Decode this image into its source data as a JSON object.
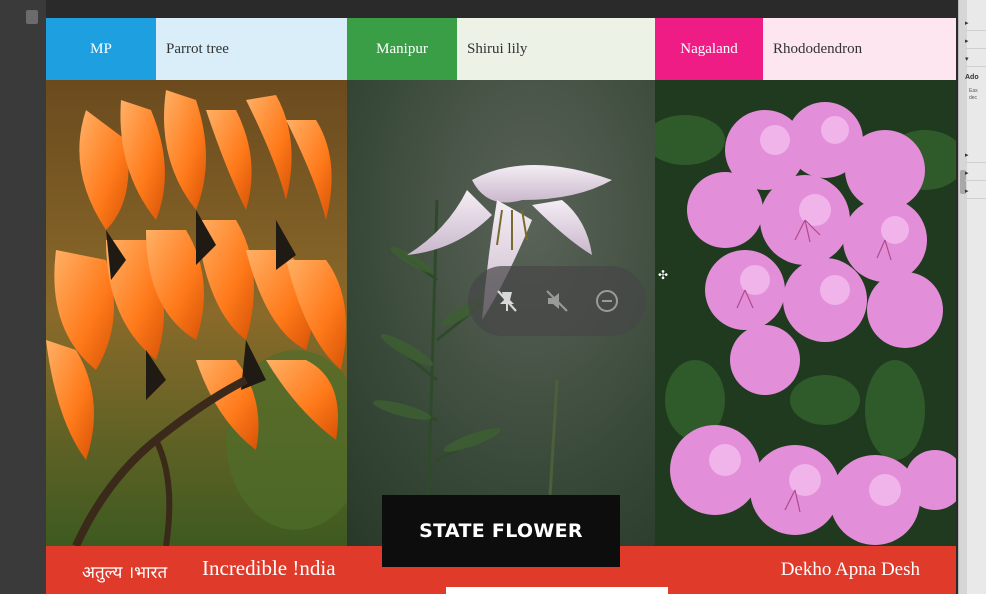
{
  "slide": {
    "columns": [
      {
        "state": "MP",
        "flower": "Parrot tree",
        "state_color": "#1e9fe0",
        "flower_bg": "#d9eef8"
      },
      {
        "state": "Manipur",
        "flower": "Shirui lily",
        "state_color": "#3a9e47",
        "flower_bg": "#ecf2e6"
      },
      {
        "state": "Nagaland",
        "flower": "Rhododendron",
        "state_color": "#ee1c84",
        "flower_bg": "#fde6ef"
      }
    ],
    "caption": "STATE FLOWER",
    "footer": {
      "hindi_logo": "अतुल्य ।भारत",
      "english_logo": "Incredible !ndia",
      "tagline": "Dekho Apna Desh",
      "color": "#e03a2a"
    }
  },
  "media_controls": {
    "buttons": [
      "pin-off-icon",
      "mute-icon",
      "minus-circle-icon"
    ]
  },
  "sidebar_panel": {
    "heading": "Ado",
    "desc": "Eas dec"
  }
}
